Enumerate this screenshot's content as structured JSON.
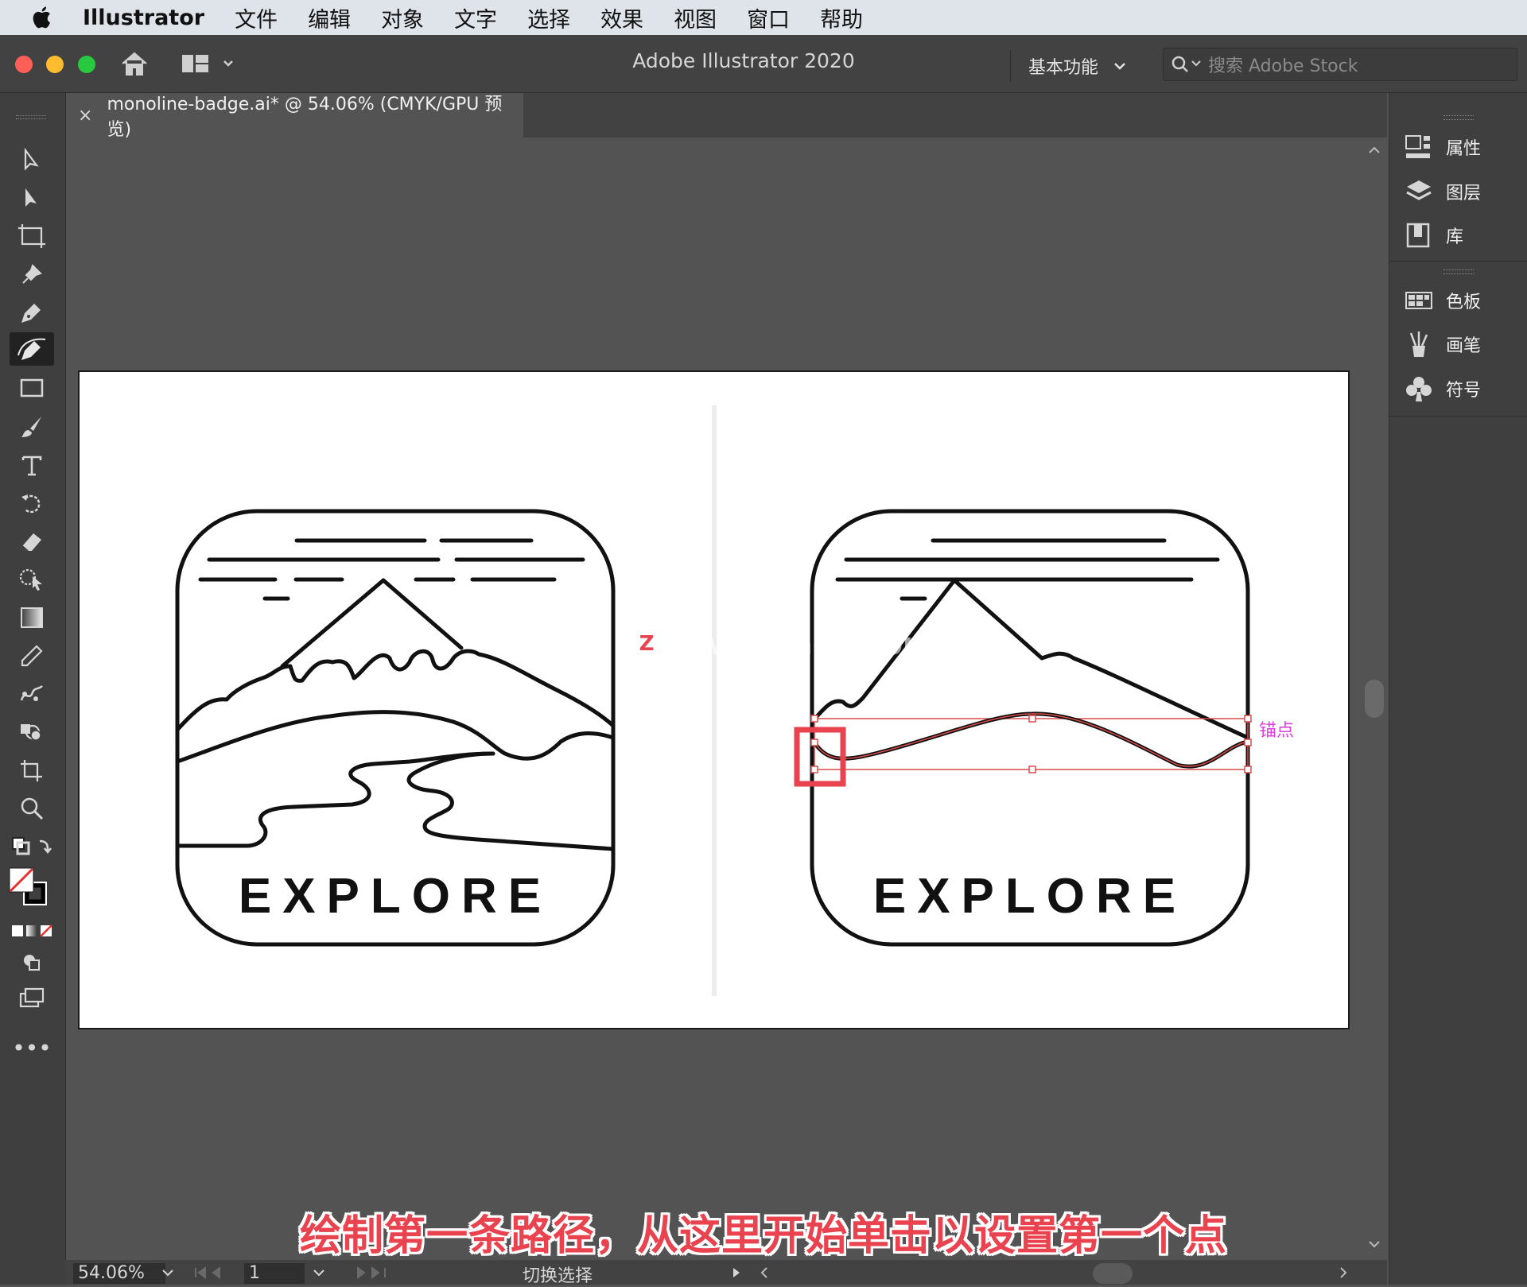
{
  "menubar": {
    "app_name": "Illustrator",
    "items": [
      "文件",
      "编辑",
      "对象",
      "文字",
      "选择",
      "效果",
      "视图",
      "窗口",
      "帮助"
    ]
  },
  "titlebar": {
    "title": "Adobe Illustrator 2020",
    "workspace": "基本功能",
    "search_placeholder": "搜索 Adobe Stock"
  },
  "document_tab": {
    "label": "monoline-badge.ai* @ 54.06% (CMYK/GPU 预览)"
  },
  "right_panel": {
    "group1": [
      {
        "label": "属性",
        "icon": "properties-icon"
      },
      {
        "label": "图层",
        "icon": "layers-icon"
      },
      {
        "label": "库",
        "icon": "libraries-icon"
      }
    ],
    "group2": [
      {
        "label": "色板",
        "icon": "swatches-icon"
      },
      {
        "label": "画笔",
        "icon": "brushes-icon"
      },
      {
        "label": "符号",
        "icon": "symbols-icon"
      }
    ]
  },
  "artwork": {
    "left_badge_text": "EXPLORE",
    "right_badge_text": "EXPLORE",
    "anchor_label": "锚点"
  },
  "watermark": "www.MacZ.com",
  "caption": "绘制第一条路径，从这里开始单击以设置第一个点",
  "status": {
    "zoom": "54.06%",
    "artboard": "1",
    "tool_state": "切换选择"
  },
  "colors": {
    "annotation_red": "#e8434e",
    "anchor_label": "#e040e0",
    "path_selection": "#d94b4b"
  }
}
